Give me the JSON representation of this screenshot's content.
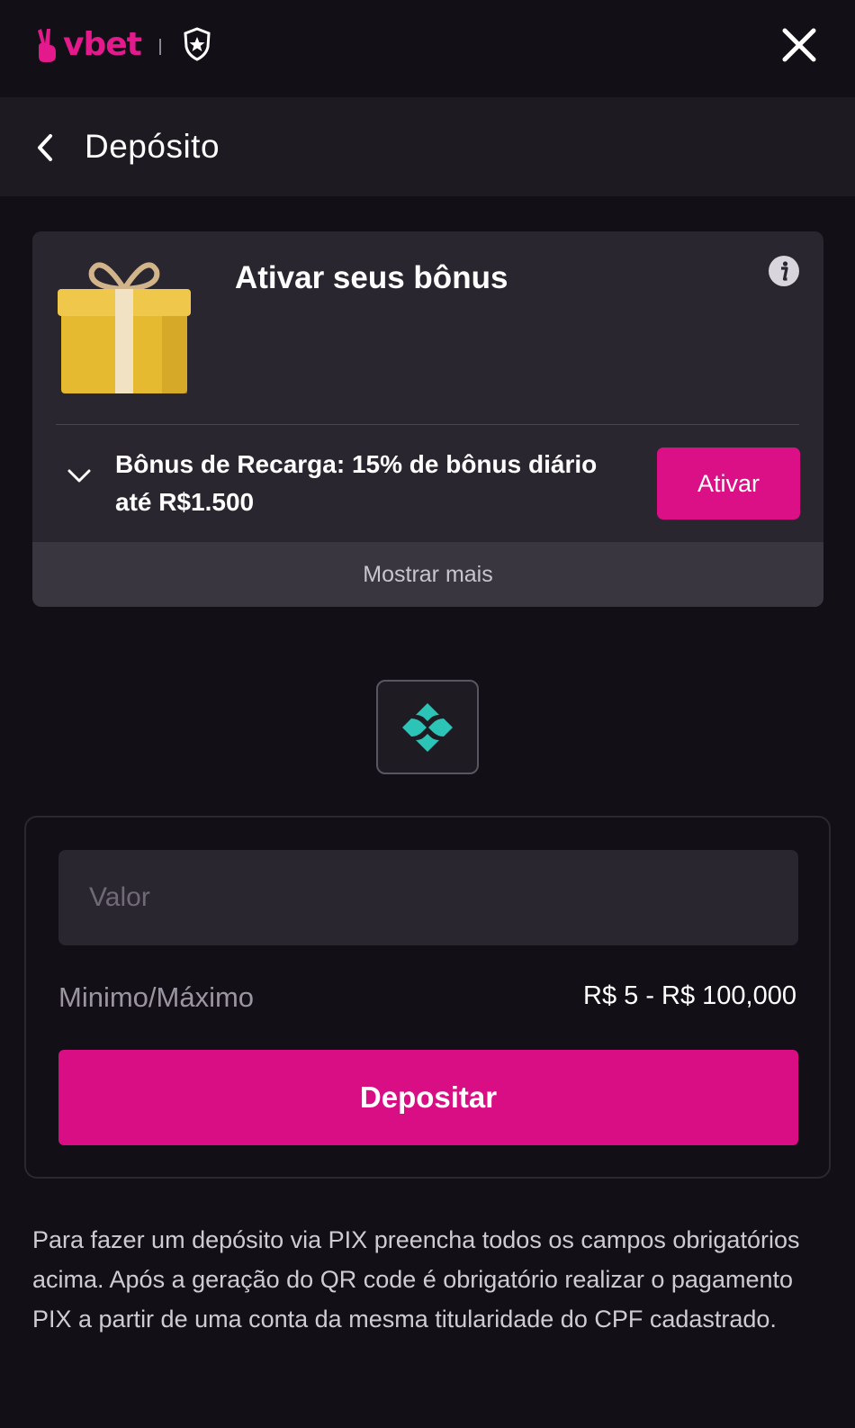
{
  "brand": {
    "name": "vbet",
    "accent_color": "#e3198c"
  },
  "topbar": {
    "icons": [
      "vbet-logo",
      "club-badge-icon",
      "close-icon"
    ]
  },
  "header": {
    "title": "Depósito",
    "back_icon": "chevron-left-icon"
  },
  "bonus": {
    "title": "Ativar seus bônus",
    "item_description": "Bônus de Recarga: 15% de bônus diário até R$1.500",
    "activate_label": "Ativar",
    "show_more_label": "Mostrar mais",
    "icons": [
      "gift-icon",
      "info-icon",
      "chevron-down-icon"
    ]
  },
  "payment_method": {
    "selected": "pix-icon"
  },
  "form": {
    "amount_placeholder": "Valor",
    "amount_value": "",
    "minmax_label": "Minimo/Máximo",
    "minmax_value": "R$ 5 - R$ 100,000",
    "deposit_label": "Depositar",
    "deposit_color": "#d90e84"
  },
  "note": "Para fazer um depósito via PIX preencha todos os campos obrigatórios acima. Após a geração do QR code é obrigatório realizar o pagamento PIX a partir de uma conta da mesma titularidade do CPF cadastrado."
}
